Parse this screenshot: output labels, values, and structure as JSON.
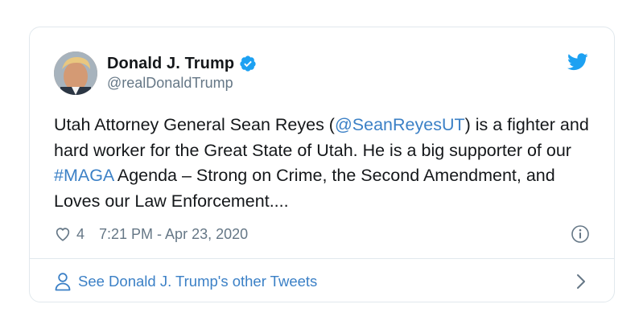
{
  "tweet": {
    "display_name": "Donald J. Trump",
    "handle": "@realDonaldTrump",
    "verified": true,
    "text_parts": {
      "p1": "Utah Attorney General Sean Reyes (",
      "mention": "@SeanReyesUT",
      "p2": ") is a fighter and hard worker for the Great State of Utah. He is a big supporter of our ",
      "hashtag": "#MAGA",
      "p3": " Agenda – Strong on Crime, the Second Amendment, and Loves our Law Enforcement...."
    },
    "like_count": "4",
    "timestamp": "7:21 PM - Apr 23, 2020"
  },
  "footer": {
    "see_more_label": "See Donald J. Trump's other Tweets"
  },
  "icons": {
    "verified": "verified-badge-icon",
    "brand": "twitter-bird-icon",
    "like": "heart-icon",
    "info": "info-icon",
    "profile": "person-icon",
    "forward": "chevron-right-icon"
  },
  "colors": {
    "link": "#3b80c6",
    "brand": "#1da1f2",
    "secondary_text": "#657786",
    "border": "#e1e8ed"
  }
}
